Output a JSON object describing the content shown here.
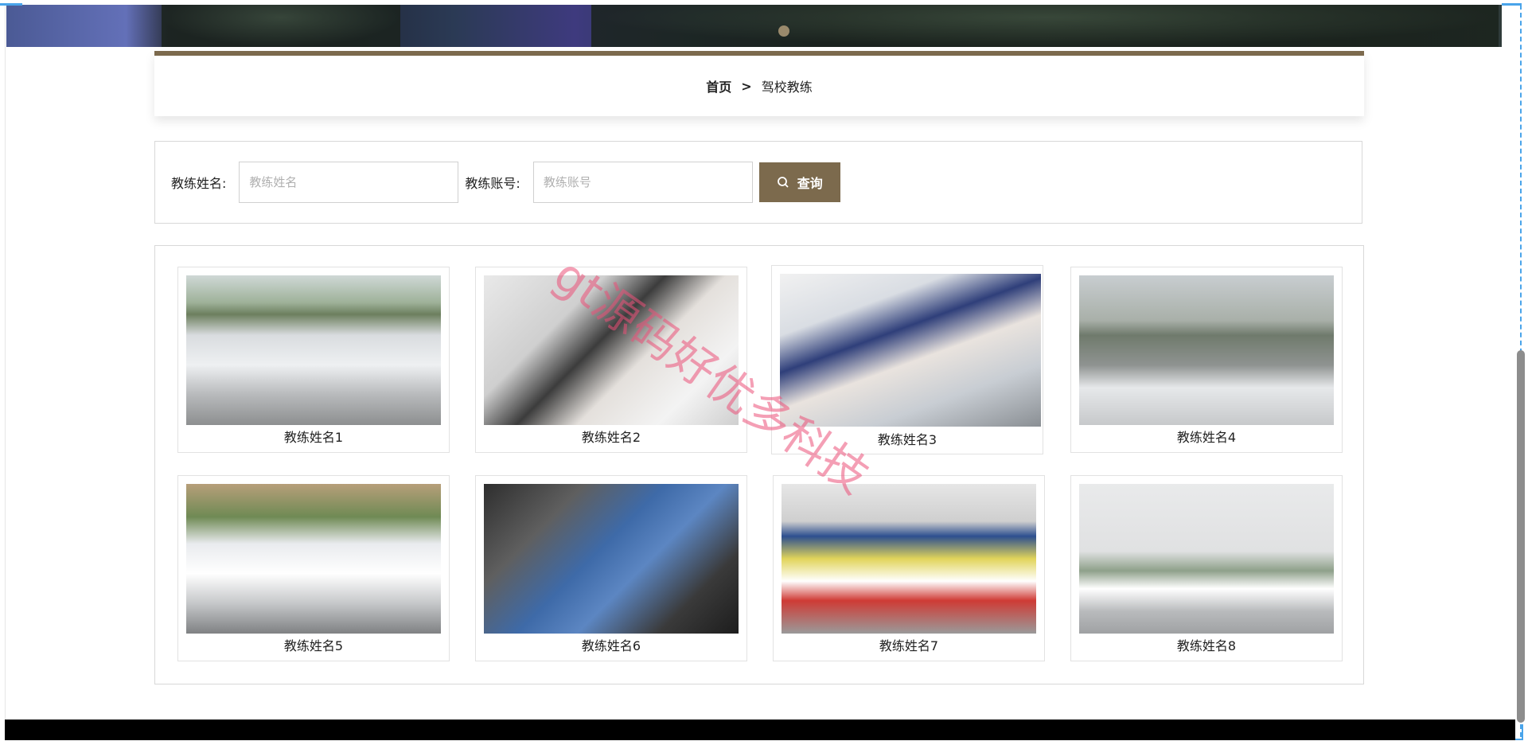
{
  "breadcrumb": {
    "home": "首页",
    "separator": ">",
    "current": "驾校教练"
  },
  "search": {
    "name_label": "教练姓名:",
    "name_placeholder": "教练姓名",
    "account_label": "教练账号:",
    "account_placeholder": "教练账号",
    "button_label": "查询"
  },
  "coaches": [
    {
      "name": "教练姓名1"
    },
    {
      "name": "教练姓名2"
    },
    {
      "name": "教练姓名3"
    },
    {
      "name": "教练姓名4"
    },
    {
      "name": "教练姓名5"
    },
    {
      "name": "教练姓名6"
    },
    {
      "name": "教练姓名7"
    },
    {
      "name": "教练姓名8"
    }
  ],
  "watermark": "gt源码好优多科技",
  "colors": {
    "accent": "#7c6a4d",
    "footer": "#000000",
    "guide": "#49a4ea"
  }
}
